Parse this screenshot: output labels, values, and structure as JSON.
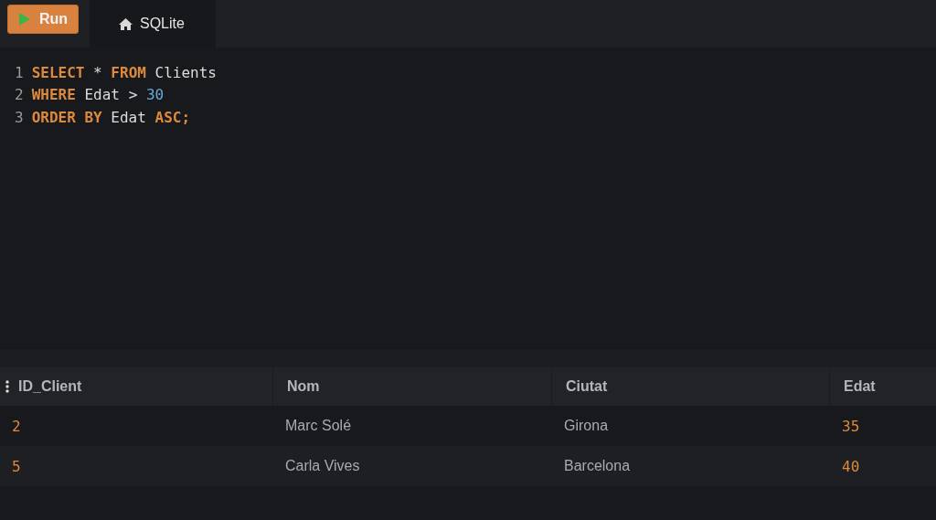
{
  "toolbar": {
    "run_button": "Run",
    "tabs": [
      {
        "label": "SQLite",
        "selected": true
      }
    ]
  },
  "editor": {
    "lines": [
      {
        "number": "1",
        "tokens": [
          {
            "kind": "keyword",
            "text": "SELECT"
          },
          {
            "kind": "plain",
            "text": "*"
          },
          {
            "kind": "keyword",
            "text": "FROM"
          },
          {
            "kind": "plain",
            "text": "Clients"
          }
        ]
      },
      {
        "number": "2",
        "tokens": [
          {
            "kind": "keyword",
            "text": "WHERE"
          },
          {
            "kind": "plain",
            "text": "Edat"
          },
          {
            "kind": "plain",
            "text": ">"
          },
          {
            "kind": "number",
            "text": "30"
          }
        ]
      },
      {
        "number": "3",
        "tokens": [
          {
            "kind": "keyword",
            "text": "ORDER BY"
          },
          {
            "kind": "plain",
            "text": "Edat"
          },
          {
            "kind": "keyword",
            "text": "ASC"
          },
          {
            "kind": "punct",
            "text": ";"
          }
        ]
      }
    ]
  },
  "table": {
    "columns": [
      "ID_Client",
      "Nom",
      "Ciutat",
      "Edat"
    ],
    "rows": [
      {
        "cells": [
          {
            "kind": "number",
            "text": "2"
          },
          {
            "kind": "text",
            "text": "Marc Solé"
          },
          {
            "kind": "text",
            "text": "Girona"
          },
          {
            "kind": "number",
            "text": "35"
          }
        ]
      },
      {
        "cells": [
          {
            "kind": "number",
            "text": "5"
          },
          {
            "kind": "text",
            "text": "Carla Vives"
          },
          {
            "kind": "text",
            "text": "Barcelona"
          },
          {
            "kind": "number",
            "text": "40"
          }
        ]
      }
    ]
  }
}
